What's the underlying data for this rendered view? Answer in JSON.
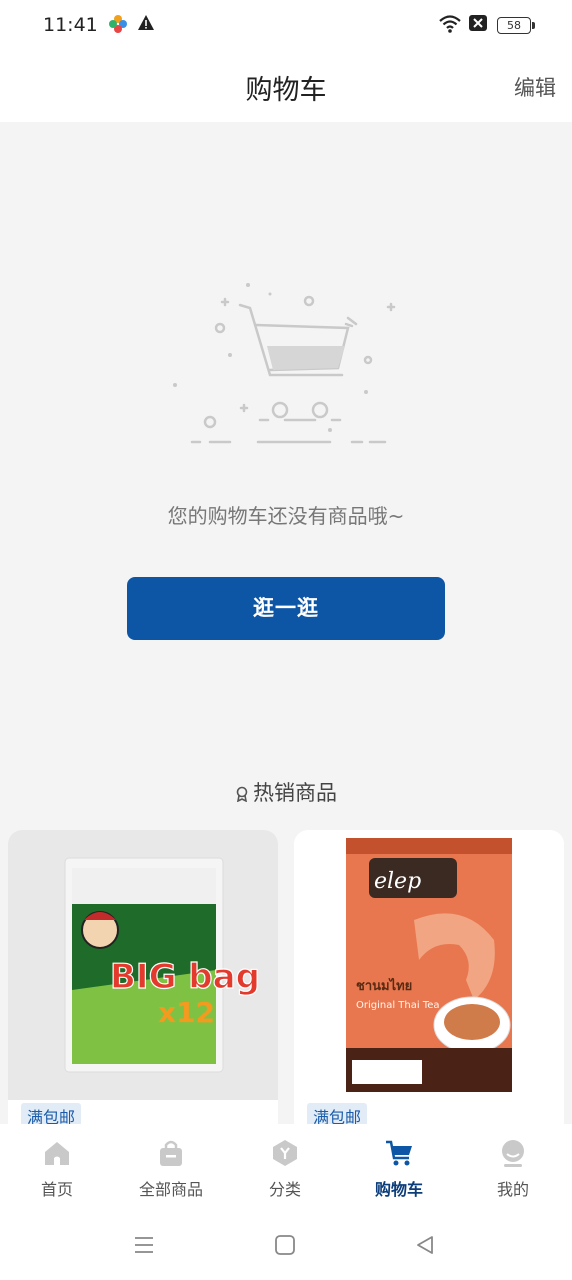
{
  "status_bar": {
    "time": "11:41",
    "battery": "58"
  },
  "header": {
    "title": "购物车",
    "edit_label": "编辑"
  },
  "empty_state": {
    "message": "您的购物车还没有商品哦~",
    "button_label": "逛一逛"
  },
  "hot_section": {
    "title": "热销商品"
  },
  "products": [
    {
      "tag": "满包邮",
      "image_title": "BIG bag",
      "image_badge": "x12"
    },
    {
      "tag": "满包邮",
      "image_brand": "elep",
      "image_subtitle": "ชานมไทย",
      "image_caption": "Original Thai Tea"
    }
  ],
  "tabs": [
    {
      "label": "首页",
      "icon": "home-icon"
    },
    {
      "label": "全部商品",
      "icon": "bag-icon"
    },
    {
      "label": "分类",
      "icon": "category-icon"
    },
    {
      "label": "购物车",
      "icon": "cart-icon",
      "active": true
    },
    {
      "label": "我的",
      "icon": "profile-icon"
    }
  ],
  "colors": {
    "primary": "#0c56a5",
    "tag_bg": "#e2ecf7",
    "tag_text": "#1b5ba8"
  }
}
